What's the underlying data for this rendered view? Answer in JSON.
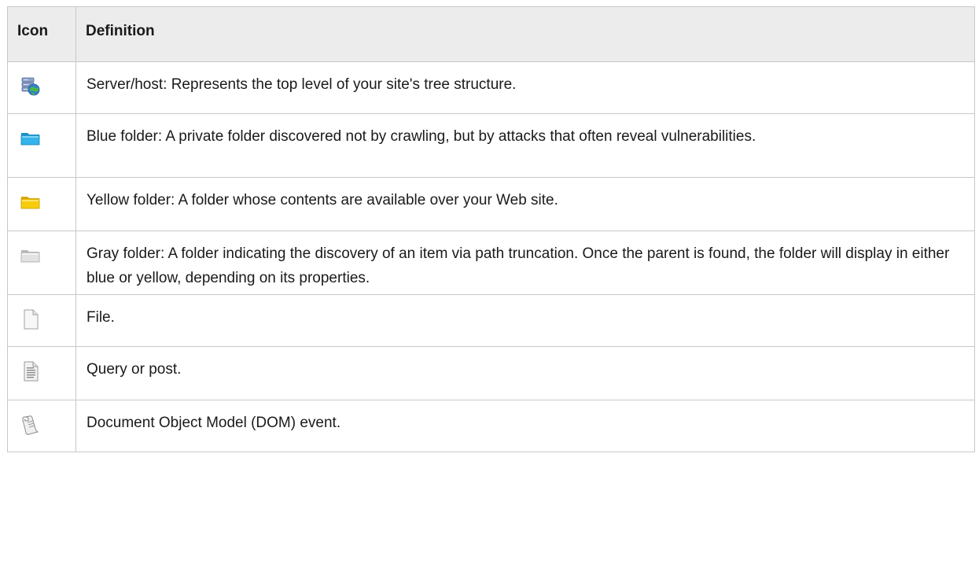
{
  "table": {
    "headers": {
      "icon": "Icon",
      "definition": "Definition"
    },
    "rows": [
      {
        "icon": "server-host-icon",
        "definition": "Server/host: Represents the top level of your site's tree structure."
      },
      {
        "icon": "blue-folder-icon",
        "definition": "Blue folder: A private folder discovered not by crawling, but by attacks that often reveal vulnerabilities."
      },
      {
        "icon": "yellow-folder-icon",
        "definition": "Yellow folder: A folder whose contents are available over your Web site."
      },
      {
        "icon": "gray-folder-icon",
        "definition": "Gray folder: A folder indicating the discovery of an item via path truncation. Once the parent is found, the folder will display in either blue or yellow, depending on its properties."
      },
      {
        "icon": "file-icon",
        "definition": "File."
      },
      {
        "icon": "query-post-icon",
        "definition": "Query or post."
      },
      {
        "icon": "dom-event-icon",
        "definition": "Document Object Model (DOM) event."
      }
    ]
  },
  "colors": {
    "header_background": "#ececec",
    "border": "#c8c8c8",
    "blue_folder": "#29a8e0",
    "yellow_folder": "#f5c800",
    "gray_folder": "#d0d0d0"
  }
}
